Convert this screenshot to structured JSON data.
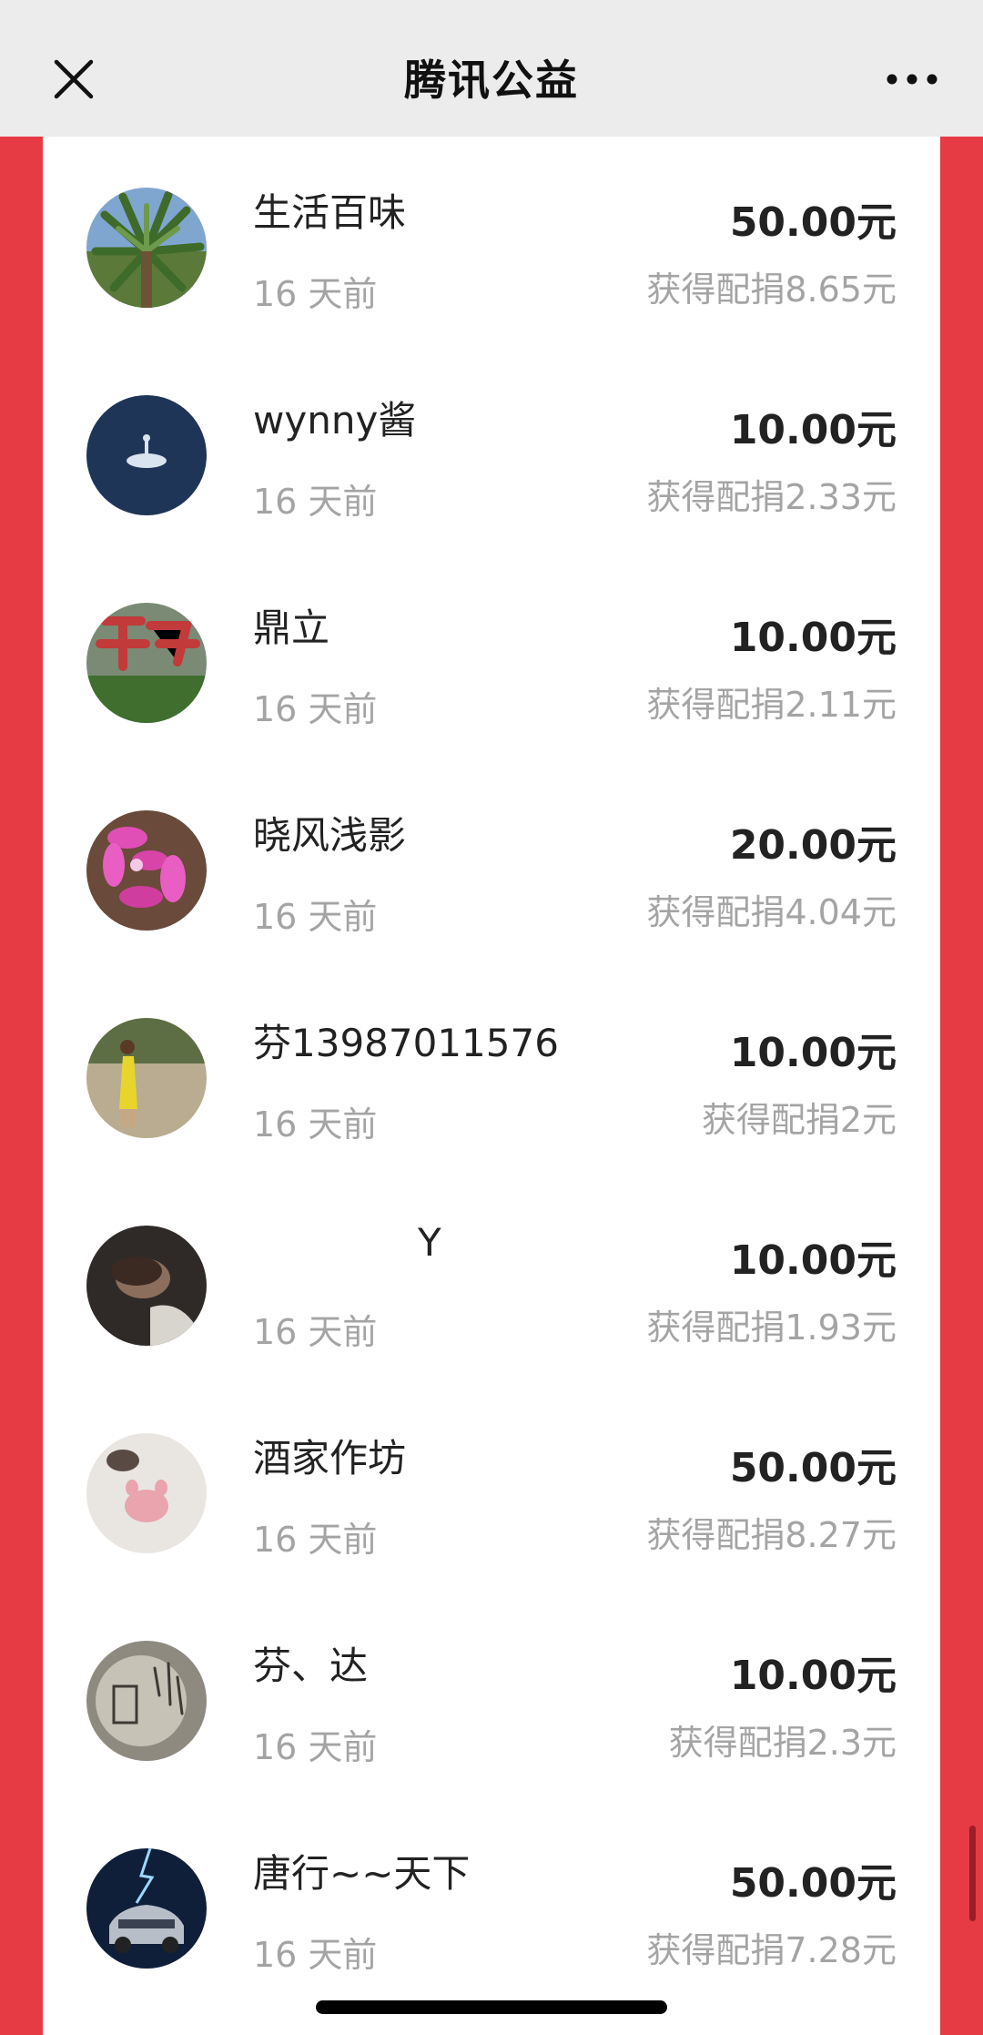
{
  "header": {
    "title": "腾讯公益",
    "close_icon": "close-icon",
    "more_icon": "more-dots-icon"
  },
  "donations": [
    {
      "name": "生活百味",
      "time": "16 天前",
      "amount": "50.00元",
      "match": "获得配捐8.65元",
      "avatar": "palm-tree-photo"
    },
    {
      "name": "wynny酱",
      "time": "16 天前",
      "amount": "10.00元",
      "match": "获得配捐2.33元",
      "avatar": "moon-illustration"
    },
    {
      "name": "鼎立",
      "time": "16 天前",
      "amount": "10.00元",
      "match": "获得配捐2.11元",
      "avatar": "red-calligraphy-photo"
    },
    {
      "name": "晓风浅影",
      "time": "16 天前",
      "amount": "20.00元",
      "match": "获得配捐4.04元",
      "avatar": "pink-flower-photo"
    },
    {
      "name": "芬13987011576",
      "time": "16 天前",
      "amount": "10.00元",
      "match": "获得配捐2元",
      "avatar": "person-in-garden-photo"
    },
    {
      "name": "Y",
      "time": "16 天前",
      "amount": "10.00元",
      "match": "获得配捐1.93元",
      "avatar": "person-portrait-photo"
    },
    {
      "name": "酒家作坊",
      "time": "16 天前",
      "amount": "50.00元",
      "match": "获得配捐8.27元",
      "avatar": "cat-paw-photo"
    },
    {
      "name": "芬、达",
      "time": "16 天前",
      "amount": "10.00元",
      "match": "获得配捐2.3元",
      "avatar": "ink-sketch-image"
    },
    {
      "name": "唐行~~天下",
      "time": "16 天前",
      "amount": "50.00元",
      "match": "获得配捐7.28元",
      "avatar": "car-lightning-photo"
    }
  ],
  "colors": {
    "background": "#e63a45",
    "card": "#ffffff",
    "header": "#ececec",
    "primary_text": "#222222",
    "secondary_text": "#a4a4a4"
  }
}
